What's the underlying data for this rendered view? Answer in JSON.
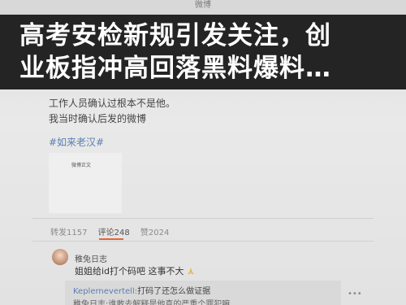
{
  "screen": {
    "title": "微博"
  },
  "headline": {
    "line1": "高考安检新规引发关注，创",
    "line2": "业板指冲高回落黑料爆料…"
  },
  "post": {
    "line1": "工作人员确认过根本不是他。",
    "line2": "我当时确认后发的微博",
    "tag": "#如来老汉#",
    "thumb": {
      "title": "微博正文",
      "line1": " ",
      "line2": " ",
      "line3": " "
    }
  },
  "counters": {
    "repost": "转发1157",
    "comment": "评论248",
    "like": "赞2024"
  },
  "comment": {
    "user": "稚兔日志",
    "text": "姐姐给id打个码吧 这事不大"
  },
  "reply": {
    "user": "Keplernevertell:",
    "text": "打码了还怎么做证据",
    "line2": "稚兔日志:谁敢去解释是他真的严重个罪犯嘛"
  }
}
